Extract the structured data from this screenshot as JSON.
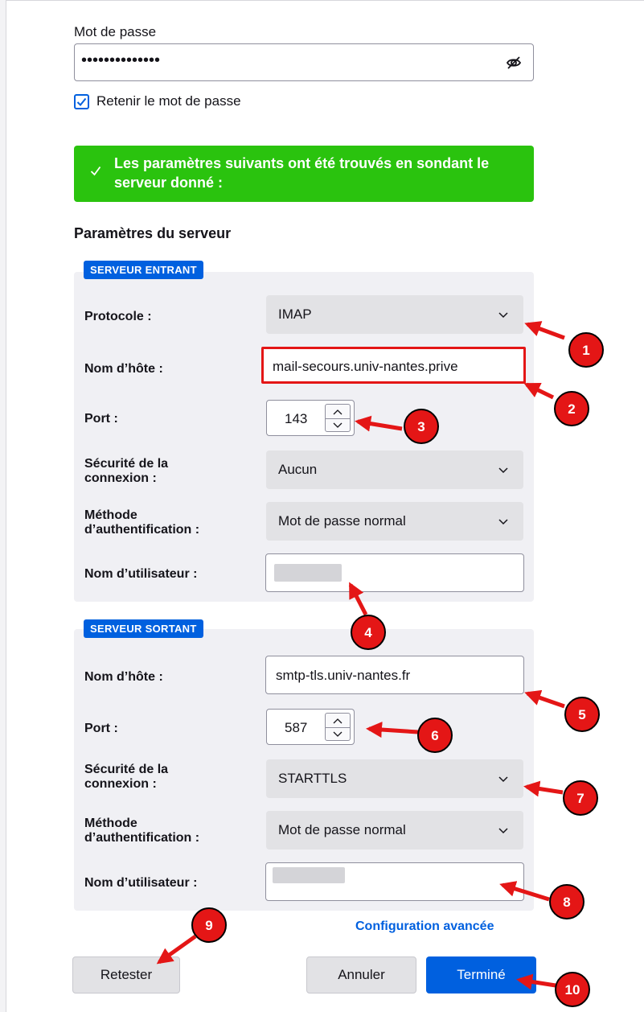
{
  "password": {
    "label": "Mot de passe",
    "value": "••••••••••••••",
    "remember_label": "Retenir le mot de passe",
    "remember_checked": true
  },
  "notice": {
    "text": "Les paramètres suivants ont été trouvés en sondant le serveur donné :",
    "color": "#2ac30e"
  },
  "server_settings_title": "Paramètres du serveur",
  "incoming": {
    "badge": "SERVEUR ENTRANT",
    "protocol_label": "Protocole :",
    "protocol_value": "IMAP",
    "hostname_label": "Nom d’hôte :",
    "hostname_value": "mail-secours.univ-nantes.prive",
    "port_label": "Port :",
    "port_value": "143",
    "security_label_line1": "Sécurité de la",
    "security_label_line2": "connexion :",
    "security_value": "Aucun",
    "auth_label_line1": "Méthode",
    "auth_label_line2": "d’authentification :",
    "auth_value": "Mot de passe normal",
    "username_label": "Nom d’utilisateur :"
  },
  "outgoing": {
    "badge": "SERVEUR SORTANT",
    "hostname_label": "Nom d’hôte :",
    "hostname_value": "smtp-tls.univ-nantes.fr",
    "port_label": "Port :",
    "port_value": "587",
    "security_label_line1": "Sécurité de la",
    "security_label_line2": "connexion :",
    "security_value": "STARTTLS",
    "auth_label_line1": "Méthode",
    "auth_label_line2": "d’authentification :",
    "auth_value": "Mot de passe normal",
    "username_label": "Nom d’utilisateur :"
  },
  "advanced_link": "Configuration avancée",
  "buttons": {
    "retest": "Retester",
    "cancel": "Annuler",
    "done": "Terminé"
  },
  "annotations": [
    "1",
    "2",
    "3",
    "4",
    "5",
    "6",
    "7",
    "8",
    "9",
    "10"
  ],
  "colors": {
    "accent": "#0060df",
    "annotation_red": "#e41616",
    "success": "#2ac30e"
  }
}
